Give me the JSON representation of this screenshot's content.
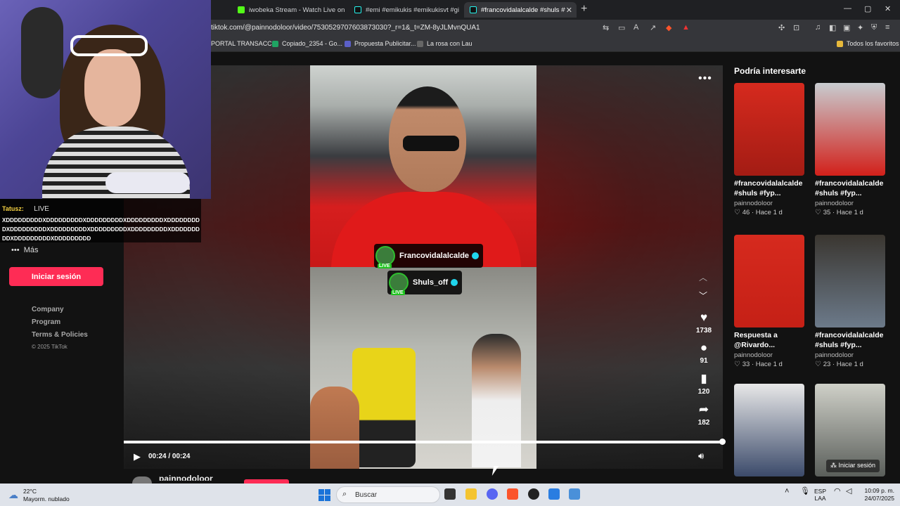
{
  "browser": {
    "tabs": [
      {
        "label": "iwobeka Stream - Watch Live on Kick",
        "color": "#53fc18"
      },
      {
        "label": "#emi #emikukis #emikukisvt #gi",
        "color": "#25f4ee"
      },
      {
        "label": "#francovidalalcalde #shuls #f",
        "color": "#25f4ee",
        "active": true
      }
    ],
    "new_tab": "+",
    "window_controls": [
      "—",
      "▢",
      "✕"
    ],
    "url": "tiktok.com/@painnodoloor/video/7530529707603873030?_r=1&_t=ZM-8yJLMvnQUA1",
    "bookmarks": [
      "PORTAL TRANSACCI...",
      "Copiado_2354 - Go...",
      "Propuesta Publicitar...",
      "La rosa con Lau"
    ],
    "all_favorites": "Todos los favoritos"
  },
  "stream_overlay": {
    "chat_user": "Tatusz",
    "chat_live": "LIVE",
    "chat_message": "XDDDDDDDDDXDDDDDDDDDXDDDDDDDDDXDDDDDDDDDXDDDDDDDDDXDDDDDDDDDXDDDDDDDDDXDDDDDDDDDXDDDDDDDDDXDDDDDDDDDXDDDDDDDDDXDDDDDDDDD"
  },
  "sidebar": {
    "more": "Más",
    "login": "Iniciar sesión",
    "links": [
      "Company",
      "Program",
      "Terms & Policies"
    ],
    "copyright": "© 2025 TikTok"
  },
  "video": {
    "live_tag_top": "Francovidalalcalde",
    "live_tag_bottom": "Shuls_off",
    "live_badge": "LIVE",
    "likes": "1738",
    "comments": "91",
    "saves": "120",
    "shares": "182",
    "time": "00:24 / 00:24",
    "progress": 1.0,
    "author": "painnodoloor"
  },
  "recommendations": {
    "title": "Podría interesarte",
    "items": [
      {
        "title": "#francovidalalcalde #shuls #fyp...",
        "author": "painnodoloor",
        "likes": "46",
        "age": "Hace 1 d",
        "colors": [
          "#d62a1e",
          "#a31c14"
        ]
      },
      {
        "title": "#francovidalalcalde #shuls #fyp...",
        "author": "painnodoloor",
        "likes": "35",
        "age": "Hace 1 d",
        "colors": [
          "#c8ccd0",
          "#d2201a"
        ]
      },
      {
        "title": "Respuesta a @Rivardo...",
        "author": "painnodoloor",
        "likes": "33",
        "age": "Hace 1 d",
        "colors": [
          "#d62a1e",
          "#c52016"
        ]
      },
      {
        "title": "#francovidalalcalde #shuls #fyp...",
        "author": "painnodoloor",
        "likes": "23",
        "age": "Hace 1 d",
        "colors": [
          "#3a3630",
          "#6c7a8a"
        ]
      },
      {
        "title": "",
        "author": "",
        "likes": "",
        "age": "",
        "colors": [
          "#e8e8e8",
          "#3b4a6a"
        ]
      },
      {
        "title": "",
        "author": "",
        "likes": "",
        "age": "",
        "colors": [
          "#cfd0c8",
          "#5a5e5a"
        ]
      }
    ],
    "float_login": "Iniciar sesión"
  },
  "taskbar": {
    "temp": "22°C",
    "weather": "Mayorm. nublado",
    "search": "Buscar",
    "lang": "ESP",
    "lang2": "LAA",
    "time": "10:09 p. m.",
    "date": "24/07/2025"
  }
}
